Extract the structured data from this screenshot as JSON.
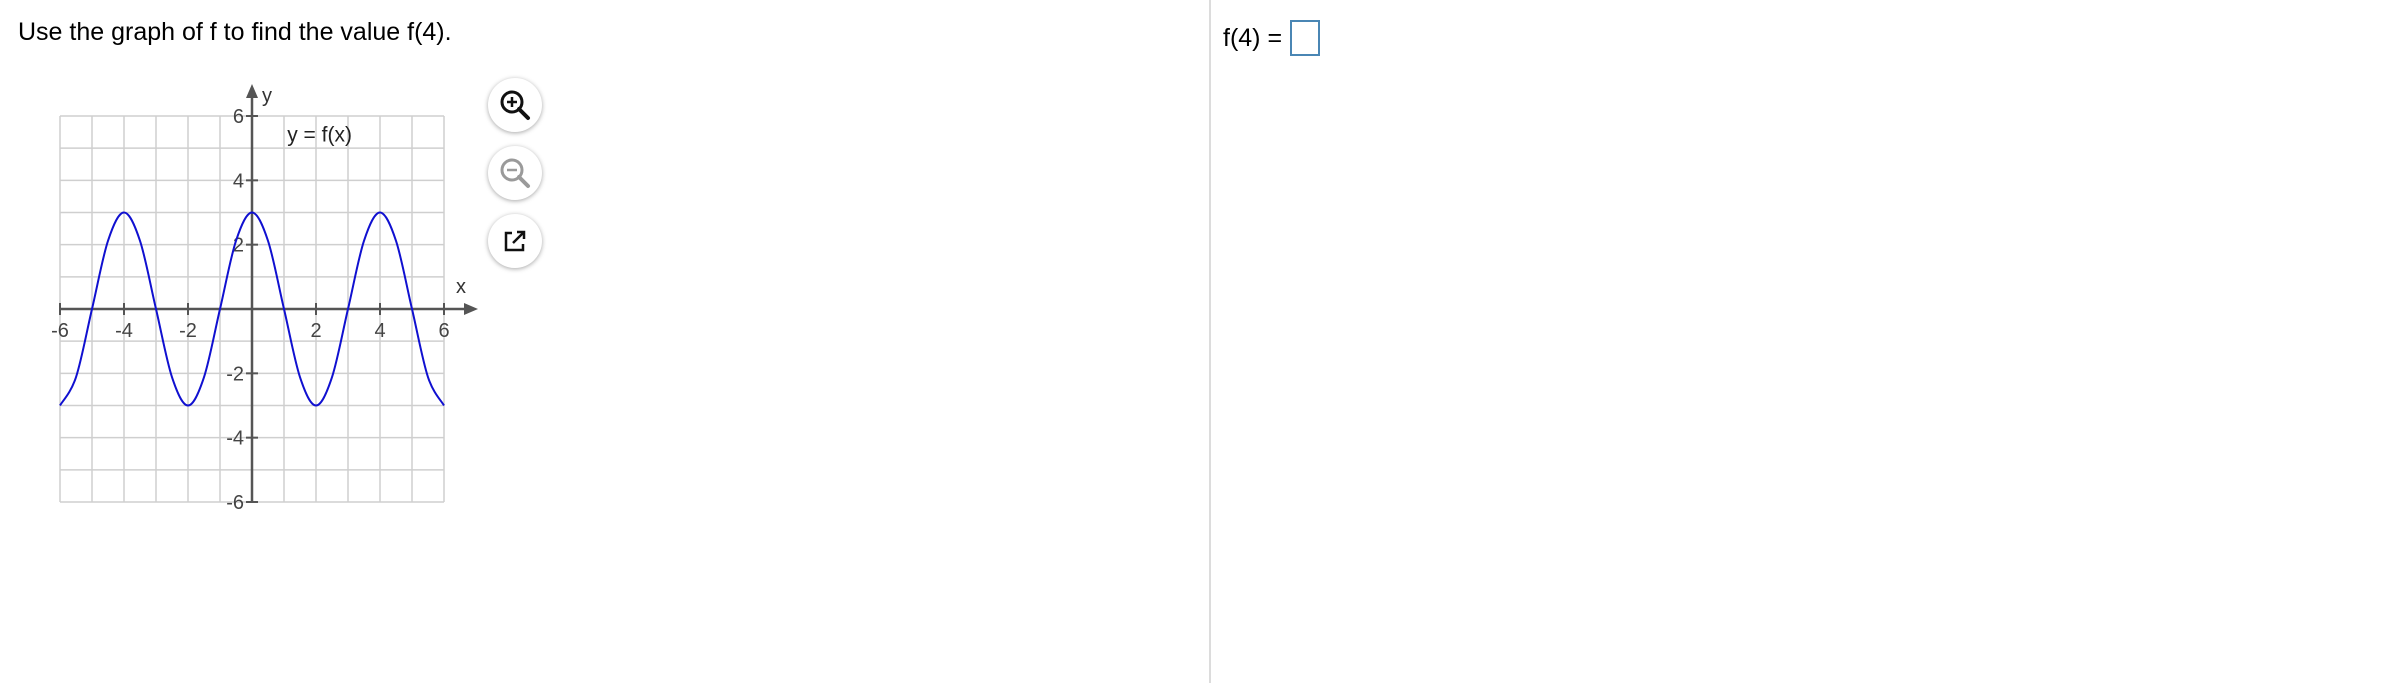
{
  "question": {
    "text": "Use the graph of f to find the value f(4)."
  },
  "answer": {
    "label": "f(4) =",
    "value": ""
  },
  "tools": {
    "zoom_in_icon": "zoom-in-icon",
    "zoom_out_icon": "zoom-out-icon",
    "popout_icon": "popout-icon"
  },
  "colors": {
    "curve": "#1010d0",
    "grid": "#cfcfcf",
    "axis": "#555555",
    "answer_border": "#4a86b4"
  },
  "chart_data": {
    "type": "line",
    "title": "",
    "curve_label": "y = f(x)",
    "xlabel": "x",
    "ylabel": "y",
    "xlim": [
      -6,
      6
    ],
    "ylim": [
      -6,
      6
    ],
    "grid": true,
    "x_ticks": [
      {
        "value": -6,
        "label": "-6"
      },
      {
        "value": -4,
        "label": "-4"
      },
      {
        "value": -2,
        "label": "-2"
      },
      {
        "value": 2,
        "label": "2"
      },
      {
        "value": 4,
        "label": "4"
      },
      {
        "value": 6,
        "label": "6"
      }
    ],
    "y_ticks": [
      {
        "value": 6,
        "label": "6"
      },
      {
        "value": 4,
        "label": "4"
      },
      {
        "value": 2,
        "label": "2"
      },
      {
        "value": -2,
        "label": "-2"
      },
      {
        "value": -4,
        "label": "-4"
      },
      {
        "value": -6,
        "label": "-6"
      }
    ],
    "series": [
      {
        "x": [
          -6,
          -5.5,
          -5,
          -4.5,
          -4,
          -3.5,
          -3,
          -2.5,
          -2,
          -1.5,
          -1,
          -0.5,
          0,
          0.5,
          1,
          1.5,
          2,
          2.5,
          3,
          3.5,
          4,
          4.5,
          5,
          5.5,
          6
        ],
        "y": [
          -3,
          -2.12,
          0,
          2.12,
          3,
          2.12,
          0,
          -2.12,
          -3,
          -2.12,
          0,
          2.12,
          3,
          2.12,
          0,
          -2.12,
          -3,
          -2.12,
          0,
          2.12,
          3,
          2.12,
          0,
          -2.12,
          -3
        ]
      }
    ]
  }
}
